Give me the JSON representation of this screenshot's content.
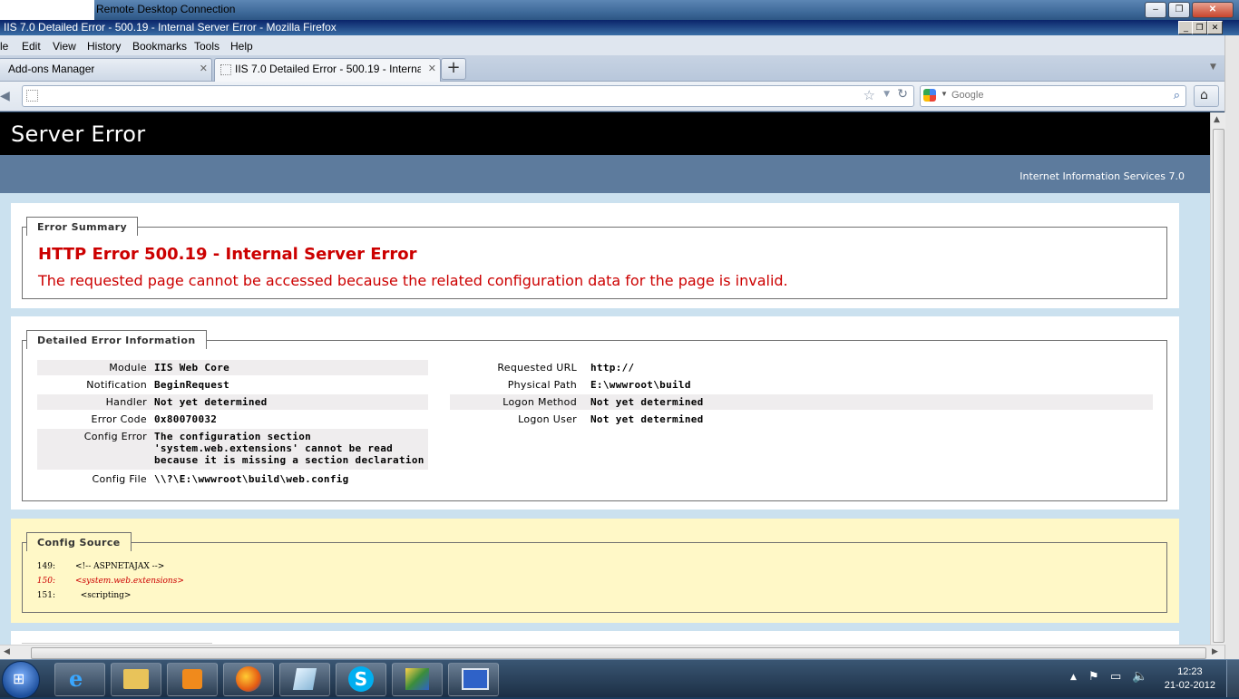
{
  "rdp": {
    "title": "Remote Desktop Connection"
  },
  "window": {
    "title": "IIS 7.0 Detailed Error - 500.19 - Internal Server Error - Mozilla Firefox"
  },
  "menu": [
    "le",
    "Edit",
    "View",
    "History",
    "Bookmarks",
    "Tools",
    "Help"
  ],
  "tabs": [
    {
      "label": "Add-ons Manager",
      "close": "✕"
    },
    {
      "label": "IIS 7.0 Detailed Error - 500.19 - Internal ...",
      "close": "✕"
    }
  ],
  "newtab": "+",
  "search": {
    "placeholder": "Google"
  },
  "page": {
    "header": "Server Error",
    "product": "Internet Information Services 7.0",
    "summary": {
      "legend": "Error Summary",
      "title": "HTTP Error 500.19 - Internal Server Error",
      "message": "The requested page cannot be accessed because the related configuration data for the page is invalid."
    },
    "detail": {
      "legend": "Detailed Error Information",
      "left": [
        {
          "k": "Module",
          "v": "IIS Web Core"
        },
        {
          "k": "Notification",
          "v": "BeginRequest"
        },
        {
          "k": "Handler",
          "v": "Not yet determined"
        },
        {
          "k": "Error Code",
          "v": "0x80070032"
        },
        {
          "k": "Config Error",
          "v": "The configuration section\n'system.web.extensions' cannot be read\nbecause it is missing a section declaration"
        },
        {
          "k": "Config File",
          "v": "\\\\?\\E:\\wwwroot\\build\\web.config"
        }
      ],
      "right": [
        {
          "k": "Requested URL",
          "v": "http://"
        },
        {
          "k": "Physical Path",
          "v": "E:\\wwwroot\\build"
        },
        {
          "k": "Logon Method",
          "v": "Not yet determined"
        },
        {
          "k": "Logon User",
          "v": "Not yet determined"
        }
      ]
    },
    "source": {
      "legend": "Config Source",
      "lines": [
        {
          "n": "149:",
          "c": "<!-- ASPNETAJAX -->"
        },
        {
          "n": "150:",
          "c": "<system.web.extensions>"
        },
        {
          "n": "151:",
          "c": "  <scripting>"
        }
      ]
    }
  },
  "clock": {
    "time": "12:23",
    "date": "21-02-2012"
  },
  "colors": {
    "header": "#000000",
    "band": "#5d7b9d",
    "error": "#cc0000",
    "sourceBg": "#fff8c7"
  }
}
